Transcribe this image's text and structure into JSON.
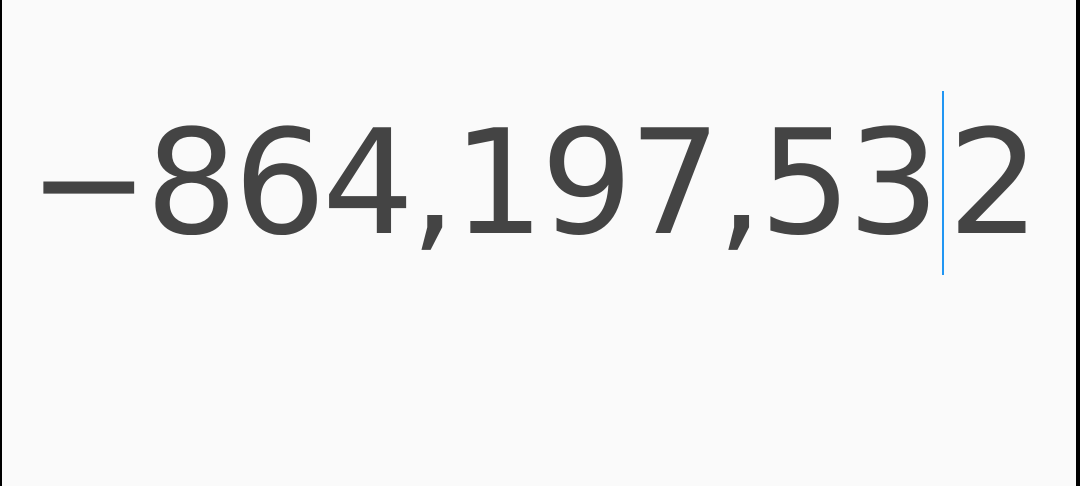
{
  "display": {
    "text_before_cursor": "−864,197,53",
    "text_after_cursor": "2"
  },
  "colors": {
    "text": "#444444",
    "cursor": "#2196f3",
    "background": "#fafafa"
  }
}
